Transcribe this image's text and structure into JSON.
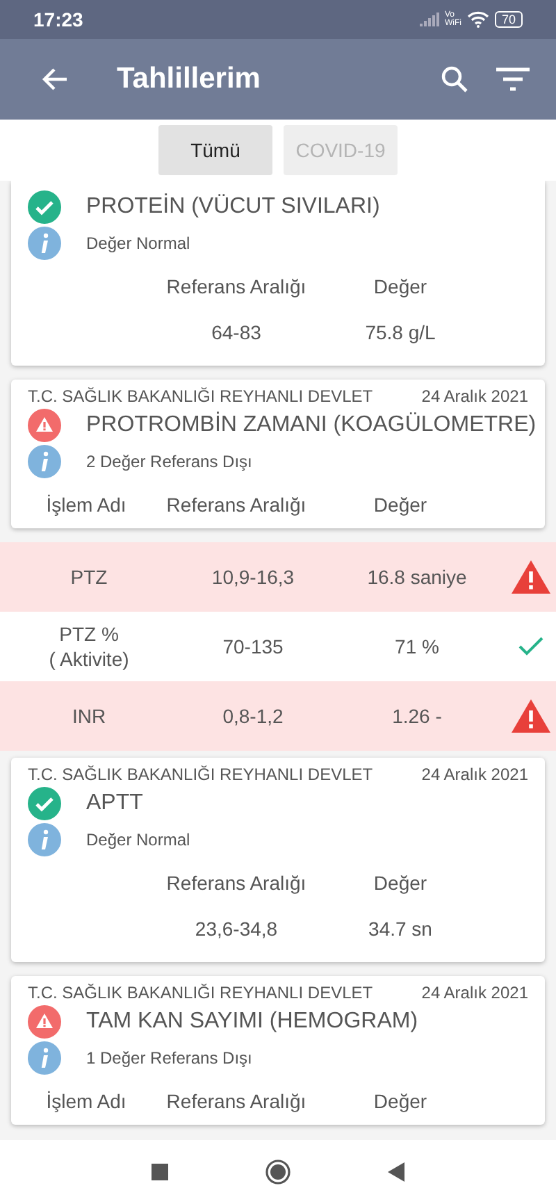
{
  "status_bar": {
    "time": "17:23",
    "network_label": "Vo WiFi",
    "battery": "70"
  },
  "app_bar": {
    "title": "Tahlillerim"
  },
  "tabs": [
    {
      "label": "Tümü",
      "selected": true
    },
    {
      "label": "COVID-19",
      "selected": false
    }
  ],
  "items": [
    {
      "kind": "card",
      "flagged": false,
      "title": "PROTEİN (VÜCUT SIVILARI)",
      "info": "Değer Normal",
      "columns": [
        "Referans Aralığı",
        "Değer"
      ],
      "values": [
        "64-83",
        "75.8 g/L"
      ]
    },
    {
      "kind": "card",
      "flagged": true,
      "hospital": "T.C. SAĞLIK BAKANLIĞI REYHANLI DEVLET",
      "date": "24 Aralık 2021",
      "title": "PROTROMBİN ZAMANI (KOAGÜLOMETRE)",
      "info": "2 Değer Referans Dışı",
      "columns": [
        "İşlem Adı",
        "Referans Aralığı",
        "Değer"
      ]
    },
    {
      "kind": "row",
      "flagged": true,
      "name": "PTZ",
      "range": "10,9-16,3",
      "value": "16.8 saniye"
    },
    {
      "kind": "row",
      "flagged": false,
      "name": "PTZ %\n( Aktivite)",
      "range": "70-135",
      "value": "71 %"
    },
    {
      "kind": "row",
      "flagged": true,
      "name": "INR",
      "range": "0,8-1,2",
      "value": "1.26 -"
    },
    {
      "kind": "card",
      "flagged": false,
      "hospital": "T.C. SAĞLIK BAKANLIĞI REYHANLI DEVLET",
      "date": "24 Aralık 2021",
      "title": "APTT",
      "info": "Değer Normal",
      "columns": [
        "Referans Aralığı",
        "Değer"
      ],
      "values": [
        "23,6-34,8",
        "34.7 sn"
      ]
    },
    {
      "kind": "card",
      "flagged": true,
      "hospital": "T.C. SAĞLIK BAKANLIĞI REYHANLI DEVLET",
      "date": "24 Aralık 2021",
      "title": "TAM KAN SAYIMI (HEMOGRAM)",
      "info": "1 Değer Referans Dışı",
      "columns": [
        "İşlem Adı",
        "Referans Aralığı",
        "Değer"
      ]
    }
  ]
}
